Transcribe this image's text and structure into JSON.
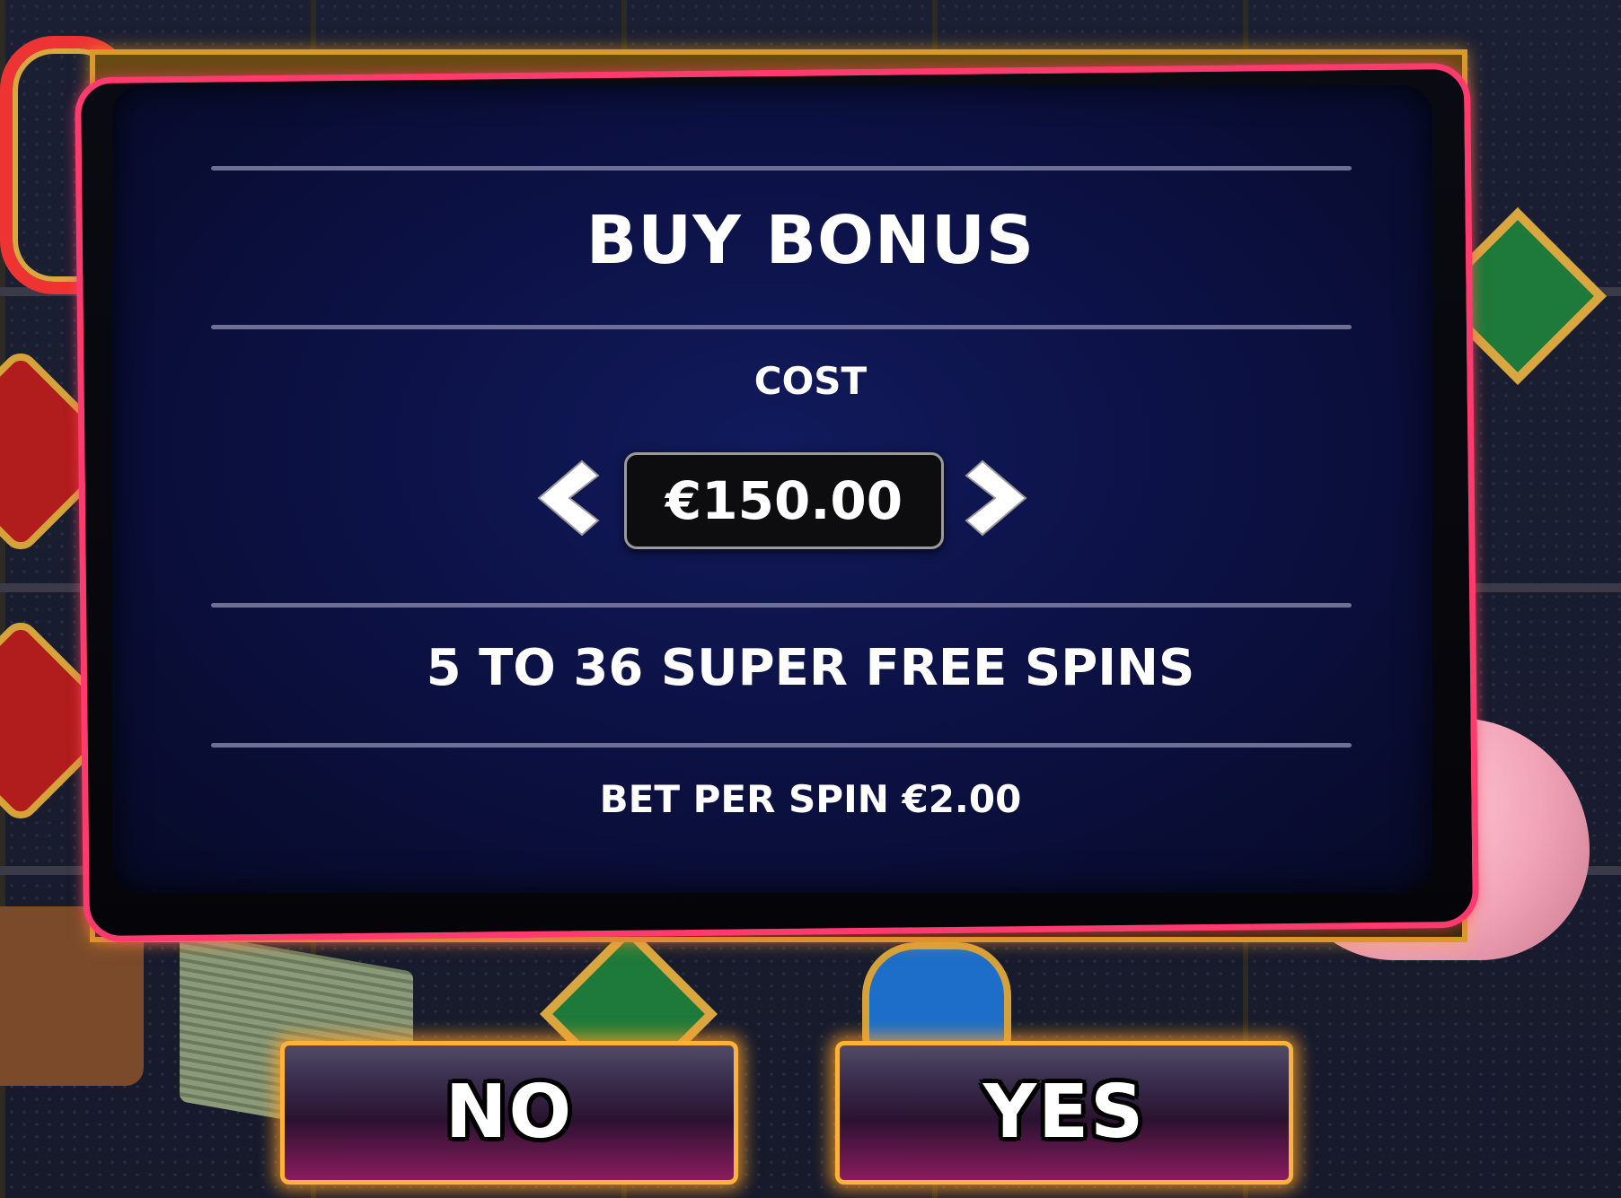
{
  "dialog": {
    "title": "BUY BONUS",
    "cost_label": "COST",
    "cost_value": "€150.00",
    "spins_text": "5 TO 36 SUPER FREE SPINS",
    "bet_text": "BET PER SPIN €2.00"
  },
  "buttons": {
    "no_label": "NO",
    "yes_label": "YES"
  },
  "icons": {
    "prev": "chevron-left-icon",
    "next": "chevron-right-icon"
  },
  "colors": {
    "panel": "#0b1040",
    "pink_frame": "#ff3a6e",
    "gold_frame": "#d99a2a",
    "button_glow": "#ffb23a",
    "text": "#ffffff"
  }
}
